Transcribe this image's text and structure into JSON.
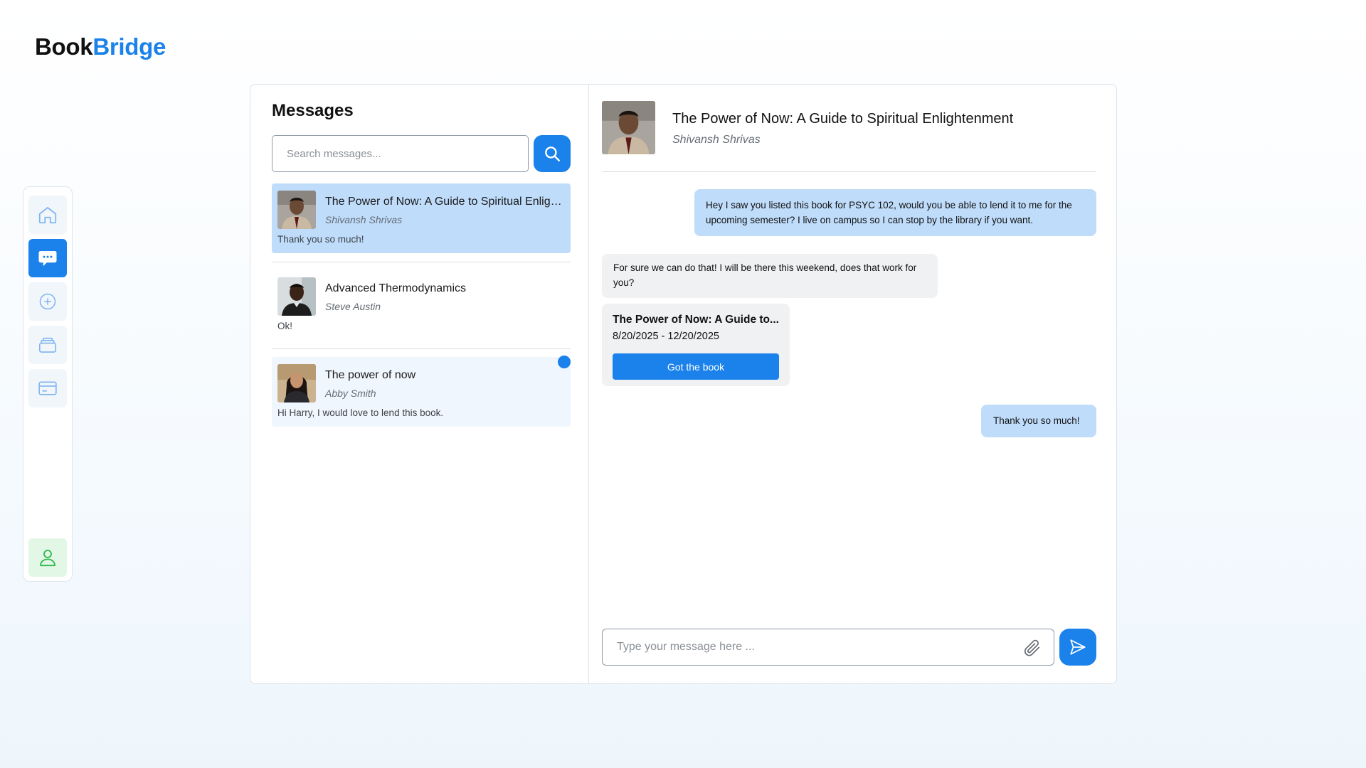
{
  "brand": {
    "part1": "Book",
    "part2": "Bridge"
  },
  "nav": [
    {
      "name": "home-icon",
      "active": false
    },
    {
      "name": "chat-icon",
      "active": true
    },
    {
      "name": "add-icon",
      "active": false
    },
    {
      "name": "archive-icon",
      "active": false
    },
    {
      "name": "card-icon",
      "active": false
    },
    {
      "name": "profile-icon",
      "active": false
    }
  ],
  "messages_panel": {
    "title": "Messages",
    "search_placeholder": "Search messages...",
    "conversations": [
      {
        "title": "The Power of Now: A Guide to Spiritual Enlightenment",
        "user": "Shivansh Shrivas",
        "preview": "Thank you so much!",
        "selected": true,
        "unread": false
      },
      {
        "title": "Advanced Thermodynamics",
        "user": "Steve Austin",
        "preview": "Ok!",
        "selected": false,
        "unread": false
      },
      {
        "title": "The power of now",
        "user": "Abby Smith",
        "preview": "Hi Harry, I would love to lend this book.",
        "selected": false,
        "unread": true
      }
    ]
  },
  "chat": {
    "title": "The Power of Now: A Guide to Spiritual Enlightenment",
    "user": "Shivansh Shrivas",
    "messages": [
      {
        "direction": "out",
        "text": "Hey I saw you listed this book for PSYC 102, would you be able to lend it to me for the upcoming semester? I live on campus so I can stop by the library if you want."
      },
      {
        "direction": "in",
        "text": "For sure we can do that! I will be there this weekend, does that work for you?"
      },
      {
        "direction": "out",
        "text": "Thank you so much!"
      }
    ],
    "book_card": {
      "title": "The Power of Now: A Guide to...",
      "dates": "8/20/2025 - 12/20/2025",
      "button": "Got the book"
    },
    "composer_placeholder": "Type your message here ..."
  },
  "colors": {
    "accent": "#1a82ea",
    "selected": "#bfdcfa",
    "incoming": "#f0f1f2"
  }
}
